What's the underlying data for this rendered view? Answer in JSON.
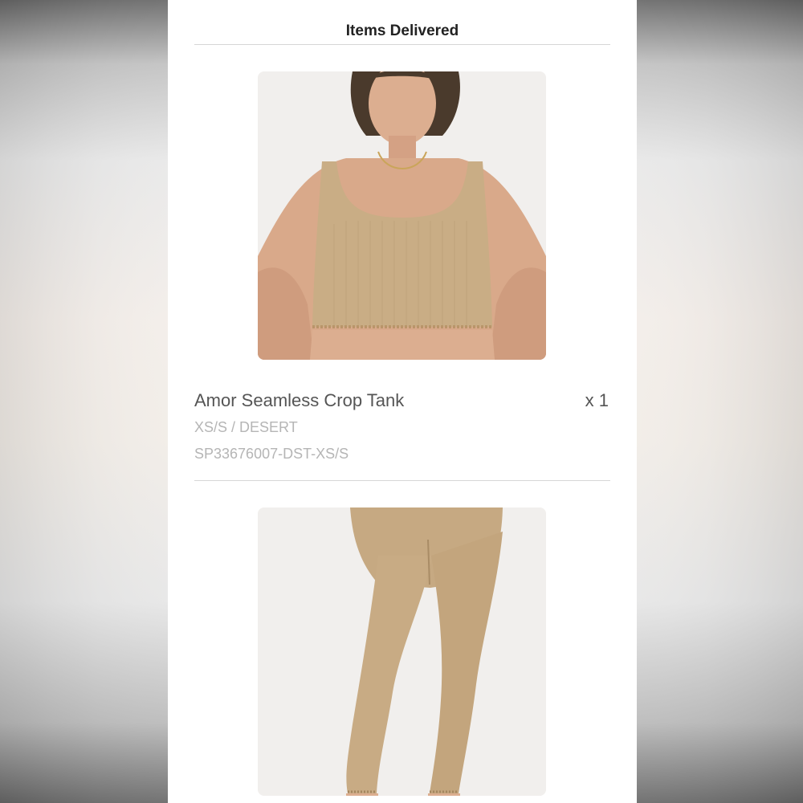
{
  "section_title": "Items Delivered",
  "items": [
    {
      "name": "Amor Seamless Crop Tank",
      "quantity": "x 1",
      "variant": "XS/S / DESERT",
      "sku": "SP33676007-DST-XS/S",
      "image_icon": "crop-tank-photo"
    },
    {
      "image_icon": "leggings-photo"
    }
  ],
  "colors": {
    "fabric": "#c9ad85",
    "skin": "#d9a98a",
    "panel": "#ffffff",
    "divider": "#d6d6d6"
  }
}
